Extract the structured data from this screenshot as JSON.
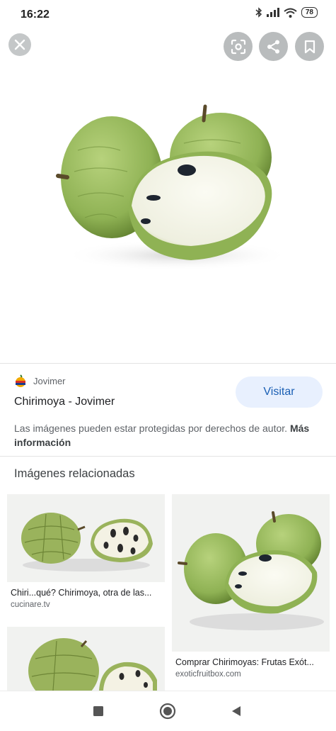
{
  "status": {
    "time": "16:22",
    "battery": "78"
  },
  "actions": {
    "close_icon": "close-icon",
    "lens_icon": "lens-icon",
    "share_icon": "share-icon",
    "save_icon": "bookmark-icon"
  },
  "result": {
    "source": "Jovimer",
    "title": "Chirimoya - Jovimer",
    "visit_label": "Visitar",
    "notice": "Las imágenes pueden estar protegidas por derechos de autor.",
    "more_info": "Más información"
  },
  "related": {
    "heading": "Imágenes relacionadas",
    "items": [
      {
        "title": "Chiri...qué? Chirimoya, otra de las...",
        "source": "cucinare.tv"
      },
      {
        "title": "Comprar Chirimoyas: Frutas Exót...",
        "source": "exoticfruitbox.com"
      }
    ]
  },
  "colors": {
    "accent": "#1a5fb4",
    "visit_bg": "#e8f0fe"
  }
}
